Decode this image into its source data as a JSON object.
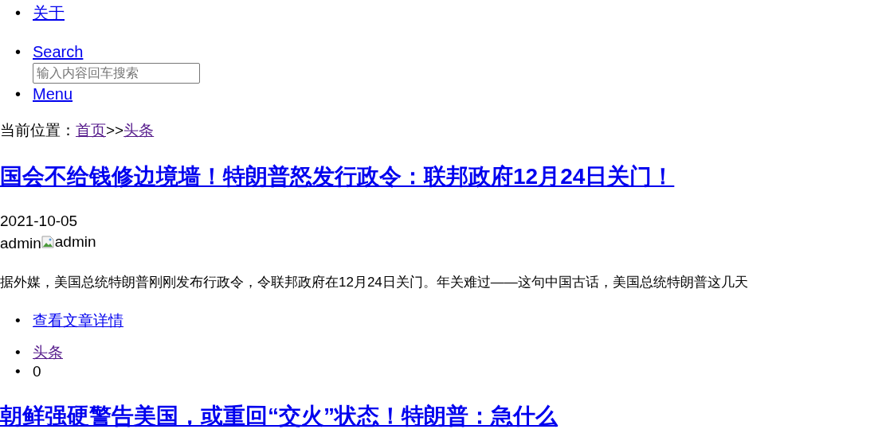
{
  "nav": {
    "items": [
      {
        "marker": "•",
        "label": "关于",
        "visited": false
      }
    ]
  },
  "search": {
    "marker": "•",
    "label": "Search",
    "placeholder": "输入内容回车搜索"
  },
  "menu": {
    "marker": "•",
    "label": "Menu"
  },
  "breadcrumb": {
    "prefix": "当前位置：",
    "separator": ">>",
    "links": [
      {
        "label": "首页",
        "visited": true
      },
      {
        "label": "头条",
        "visited": true
      }
    ]
  },
  "articles": [
    {
      "title": "国会不给钱修边境墙！特朗普怒发行政令：联邦政府12月24日关门！",
      "date": "2021-10-05",
      "author": "admin",
      "author_image_alt": "admin",
      "excerpt": "据外媒，美国总统特朗普刚刚发布行政令，令联邦政府在12月24日关门。年关难过——这句中国古话，美国总统特朗普这几天",
      "more": {
        "marker": "•",
        "label": "查看文章详情"
      },
      "category": {
        "marker": "•",
        "label": "头条",
        "visited": true
      },
      "comments": {
        "marker": "•",
        "label": "0"
      }
    },
    {
      "title": "朝鲜强硬警告美国，或重回“交火”状态！特朗普：急什么"
    }
  ]
}
